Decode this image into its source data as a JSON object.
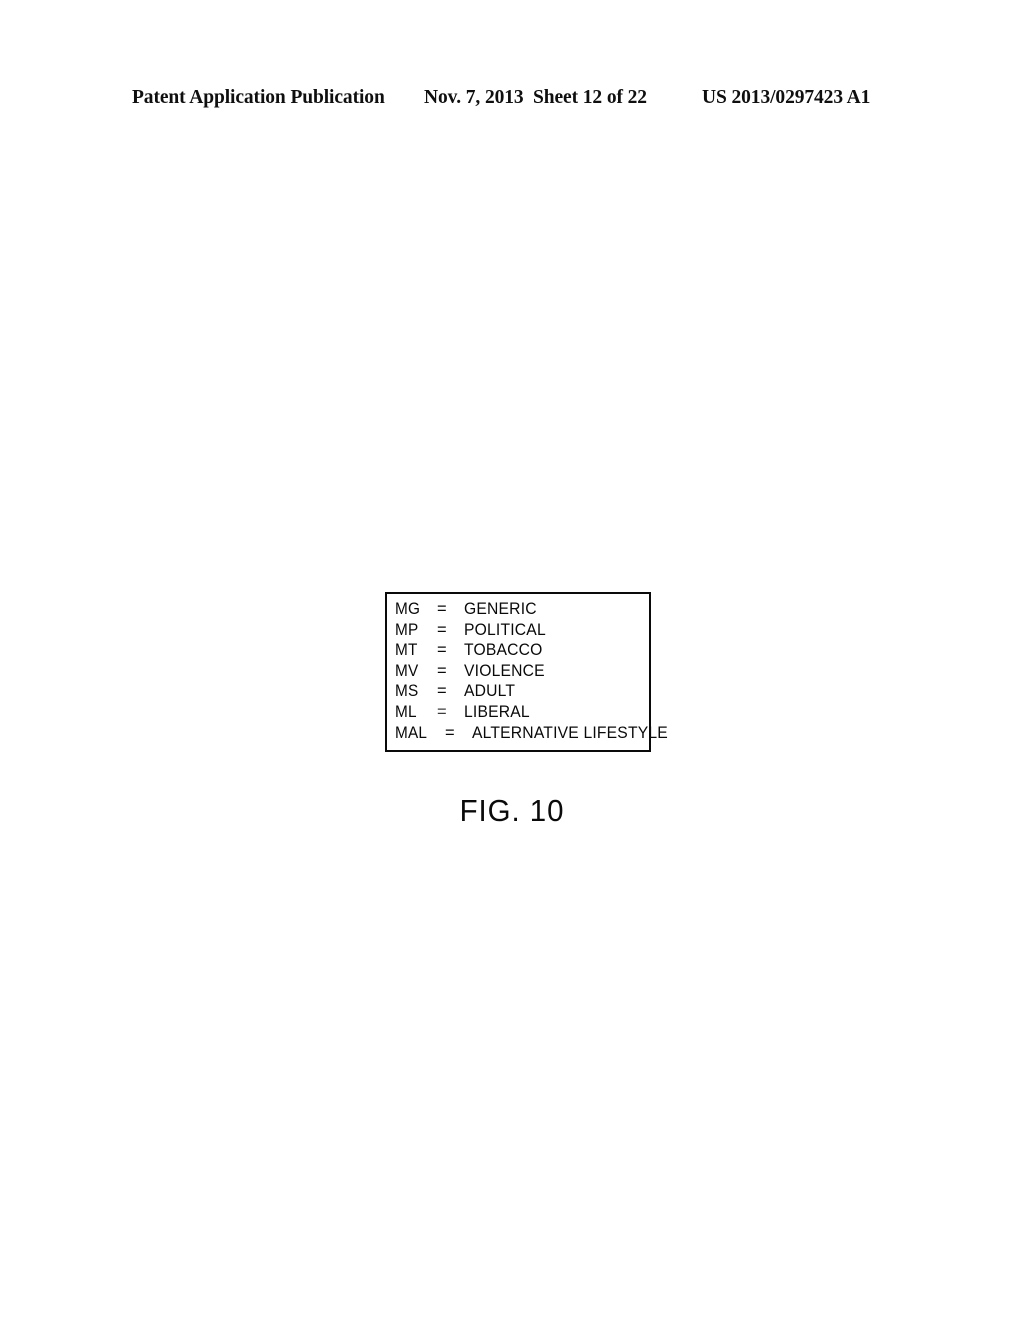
{
  "header": {
    "publication": "Patent Application Publication",
    "date": "Nov. 7, 2013",
    "sheet": "Sheet 12 of 22",
    "patent_number": "US 2013/0297423 A1"
  },
  "figure": {
    "caption": "FIG. 10",
    "legend": {
      "separator": "=",
      "entries": [
        {
          "abbr": "MG",
          "value": "GENERIC"
        },
        {
          "abbr": "MP",
          "value": "POLITICAL"
        },
        {
          "abbr": "MT",
          "value": "TOBACCO"
        },
        {
          "abbr": "MV",
          "value": "VIOLENCE"
        },
        {
          "abbr": "MS",
          "value": "ADULT"
        },
        {
          "abbr": "ML",
          "value": "LIBERAL"
        },
        {
          "abbr": "MAL",
          "value": "ALTERNATIVE LIFESTYLE"
        }
      ]
    }
  },
  "colors": {
    "ink": "#0a0a0a",
    "page": "#ffffff"
  }
}
